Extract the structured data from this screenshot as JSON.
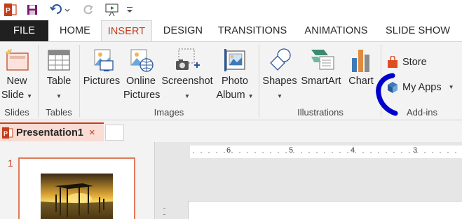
{
  "colors": {
    "accent": "#c43e1c",
    "annotation": "#0000cc"
  },
  "tabs": {
    "file": "FILE",
    "home": "HOME",
    "insert": "INSERT",
    "design": "DESIGN",
    "transitions": "TRANSITIONS",
    "animations": "ANIMATIONS",
    "slideshow": "SLIDE SHOW"
  },
  "ribbon": {
    "new_slide": [
      "New",
      "Slide"
    ],
    "table": "Table",
    "pictures": "Pictures",
    "online_pictures": [
      "Online",
      "Pictures"
    ],
    "screenshot": "Screenshot",
    "photo_album": [
      "Photo",
      "Album"
    ],
    "shapes": "Shapes",
    "smartart": "SmartArt",
    "chart": "Chart",
    "store": "Store",
    "my_apps": "My Apps",
    "groups": {
      "slides": "Slides",
      "tables": "Tables",
      "images": "Images",
      "illustrations": "Illustrations",
      "addins": "Add-ins"
    }
  },
  "document": {
    "tab_title": "Presentation1",
    "close": "×"
  },
  "thumbnails": {
    "slide_number": "1"
  },
  "ruler": {
    "labels": [
      "6",
      "5",
      "4",
      "3"
    ]
  }
}
